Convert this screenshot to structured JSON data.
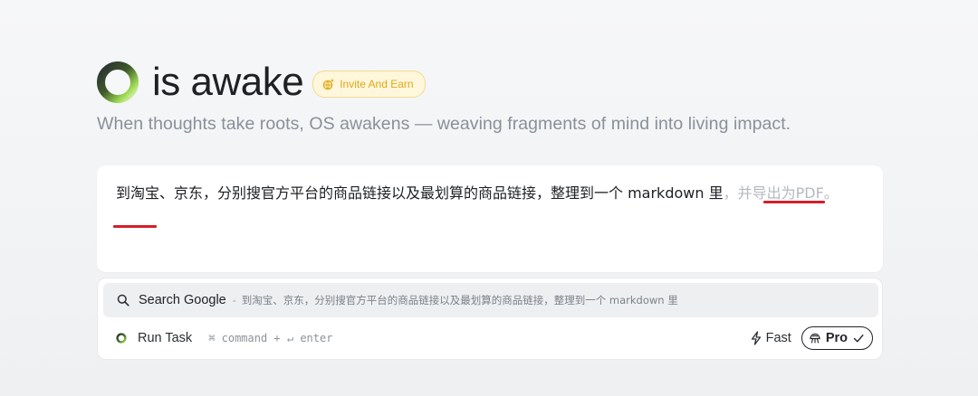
{
  "header": {
    "title": "is awake",
    "invite_label": "Invite And Earn",
    "tagline": "When thoughts take roots, OS awakens — weaving fragments of mind into living impact."
  },
  "prompt": {
    "typed_text": "到淘宝、京东，分别搜官方平台的商品链接以及最划算的商品链接，整理到一个 markdown 里",
    "ghost_text": "，并导出为PDF。"
  },
  "suggestions": {
    "search_label": "Search Google",
    "search_separator": "-",
    "search_query": "到淘宝、京东，分别搜官方平台的商品链接以及最划算的商品链接，整理到一个 markdown 里",
    "run_label": "Run Task",
    "run_shortcut": "⌘ command + ↵ enter"
  },
  "modes": {
    "fast_label": "Fast",
    "pro_label": "Pro",
    "selected": "Pro"
  },
  "colors": {
    "accent_gold": "#e0a816",
    "annotation_red": "#d2202a",
    "logo_green": "#8fd14f"
  },
  "icons": {
    "logo": "ring-logo-icon",
    "invite": "globe-sparkle-icon",
    "search": "search-icon",
    "run": "run-ring-icon",
    "fast": "lightning-icon",
    "pro": "brain-icon",
    "check": "check-icon"
  }
}
